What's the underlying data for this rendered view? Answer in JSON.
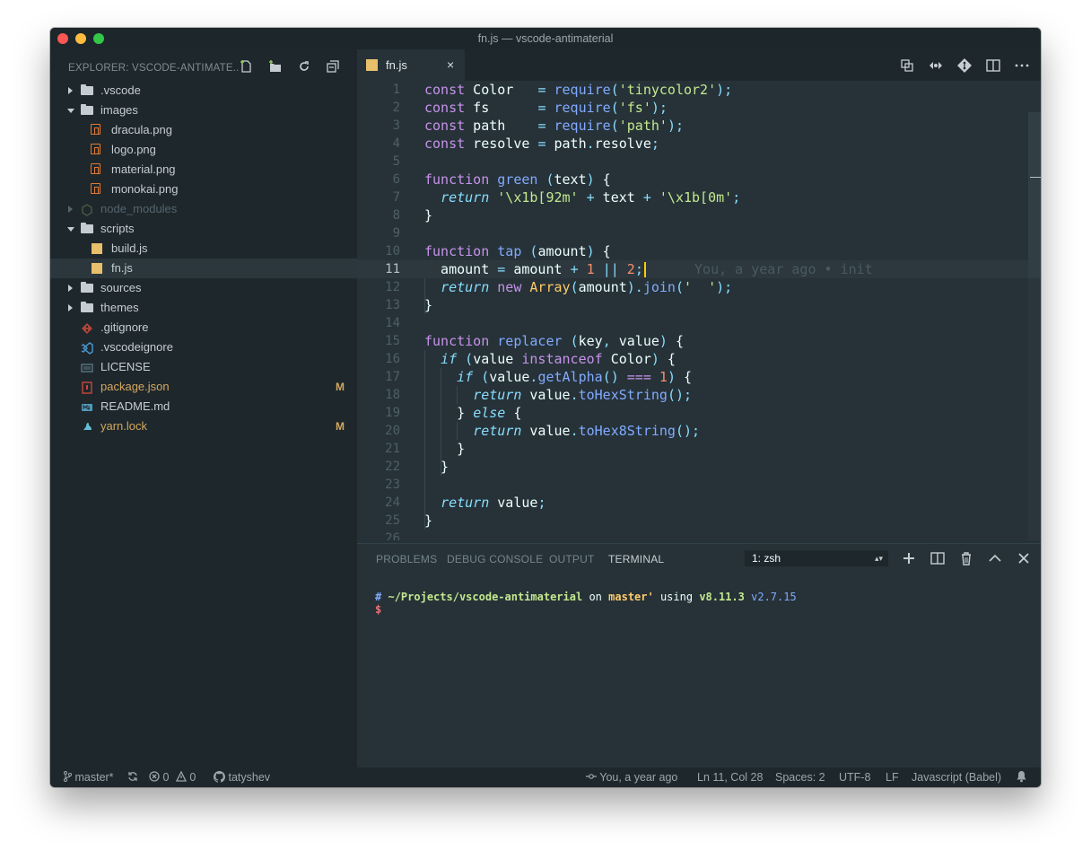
{
  "window": {
    "title": "fn.js — vscode-antimaterial"
  },
  "sidebar": {
    "header": "EXPLORER: VSCODE-ANTIMATE...",
    "items": [
      {
        "label": ".vscode",
        "kind": "folder",
        "expanded": false
      },
      {
        "label": "images",
        "kind": "folder",
        "expanded": true
      },
      {
        "label": "dracula.png",
        "kind": "png"
      },
      {
        "label": "logo.png",
        "kind": "png"
      },
      {
        "label": "material.png",
        "kind": "png"
      },
      {
        "label": "monokai.png",
        "kind": "png"
      },
      {
        "label": "node_modules",
        "kind": "node",
        "expanded": false
      },
      {
        "label": "scripts",
        "kind": "folder",
        "expanded": true
      },
      {
        "label": "build.js",
        "kind": "js"
      },
      {
        "label": "fn.js",
        "kind": "js",
        "selected": true
      },
      {
        "label": "sources",
        "kind": "folder",
        "expanded": false
      },
      {
        "label": "themes",
        "kind": "folder",
        "expanded": false
      },
      {
        "label": ".gitignore",
        "kind": "git-icon"
      },
      {
        "label": ".vscodeignore",
        "kind": "vscode-icon"
      },
      {
        "label": "LICENSE",
        "kind": "license-icon"
      },
      {
        "label": "package.json",
        "kind": "json",
        "badge": "M"
      },
      {
        "label": "README.md",
        "kind": "md"
      },
      {
        "label": "yarn.lock",
        "kind": "yarn",
        "badge": "M"
      }
    ]
  },
  "editor": {
    "tab": {
      "label": "fn.js",
      "close": "×"
    },
    "line_numbers": [
      "1",
      "2",
      "3",
      "4",
      "5",
      "6",
      "7",
      "8",
      "9",
      "10",
      "11",
      "12",
      "13",
      "14",
      "15",
      "16",
      "17",
      "18",
      "19",
      "20",
      "21",
      "22",
      "23",
      "24",
      "25",
      "26"
    ],
    "active_line": "11",
    "blame": "You, a year ago • init"
  },
  "panel": {
    "tabs": [
      "PROBLEMS",
      "DEBUG CONSOLE",
      "OUTPUT",
      "TERMINAL"
    ],
    "active_tab": "TERMINAL",
    "terminal_select": "1: zsh",
    "terminal": {
      "hash": "#",
      "path": "~/Projects/vscode-antimaterial",
      "on": "on",
      "branch": "master'",
      "using": "using",
      "node": "v8.11.3",
      "python": "v2.7.15",
      "prompt": "$"
    }
  },
  "statusbar": {
    "branch": "master*",
    "errors": "0",
    "warnings": "0",
    "user": "tatyshev",
    "blame": "You, a year ago",
    "position": "Ln 11, Col 28",
    "spaces": "Spaces: 2",
    "encoding": "UTF-8",
    "eol": "LF",
    "language": "Javascript (Babel)"
  },
  "colors": {
    "background": "#263238",
    "sidebar": "#1e272c",
    "keyword": "#c792ea",
    "function": "#82aaff",
    "string": "#c3e88d",
    "number": "#f78c6c",
    "modified": "#d3a85f"
  }
}
